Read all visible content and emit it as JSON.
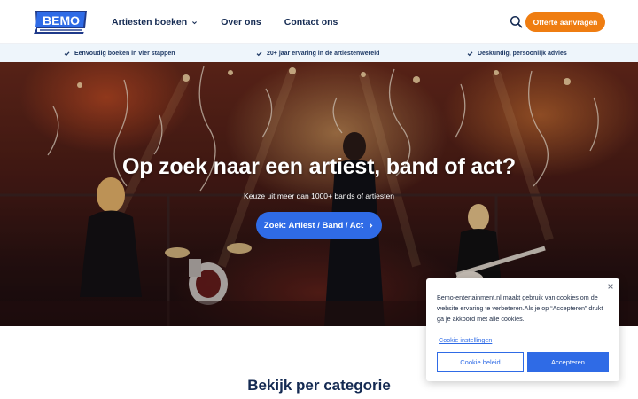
{
  "brand": {
    "logo_text": "BEMO",
    "logo_tagline": "ARTIESTEN, BANDS EN ACTS BOEKEN"
  },
  "colors": {
    "accent_orange": "#ef7d11",
    "primary_blue": "#2f6be6",
    "navy": "#142a52",
    "usp_bg": "#eef5fb"
  },
  "nav": {
    "items": [
      {
        "label": "Artiesten boeken",
        "has_dropdown": true
      },
      {
        "label": "Over ons"
      },
      {
        "label": "Contact ons"
      }
    ],
    "search_icon": "search-icon",
    "cta_label": "Offerte aanvragen"
  },
  "usps": [
    {
      "icon": "check-icon",
      "label": "Eenvoudig boeken in vier stappen"
    },
    {
      "icon": "check-icon",
      "label": "20+ jaar ervaring in de artiestenwereld"
    },
    {
      "icon": "check-icon",
      "label": "Deskundig, persoonlijk advies"
    }
  ],
  "hero": {
    "title": "Op zoek naar een artiest, band of act?",
    "subtitle": "Keuze uit meer dan 1000+ bands of artiesten",
    "button_label": "Zoek: Artiest / Band / Act",
    "button_icon": "chevron-right-icon"
  },
  "categories": {
    "title": "Bekijk per categorie"
  },
  "cookie": {
    "text": "Bemo-entertainment.nl maakt gebruik van cookies om de website ervaring te verbeteren.Als je op “Accepteren” drukt ga je akkoord met alle cookies.",
    "settings_link": "Cookie instellingen",
    "policy_button": "Cookie beleid",
    "accept_button": "Accepteren",
    "close_icon": "close-icon"
  }
}
